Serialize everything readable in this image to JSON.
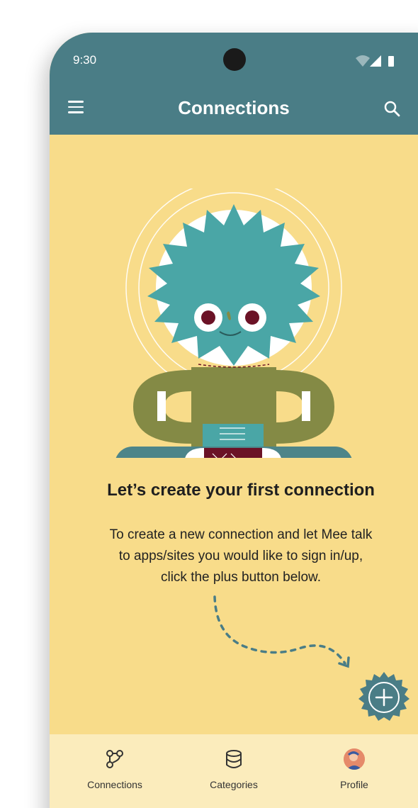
{
  "status_bar": {
    "time": "9:30"
  },
  "app_bar": {
    "title": "Connections"
  },
  "empty_state": {
    "headline": "Let’s create your first connection",
    "body_lines": [
      "To create a new connection and let Mee talk",
      "to apps/sites you would like to sign in/up,",
      "click the plus button below."
    ]
  },
  "fab": {
    "icon": "plus-icon"
  },
  "bottom_nav": {
    "items": [
      {
        "label": "Connections",
        "icon": "connections-icon"
      },
      {
        "label": "Categories",
        "icon": "database-icon"
      },
      {
        "label": "Profile",
        "icon": "avatar-icon"
      }
    ]
  },
  "colors": {
    "primary": "#4a7d86",
    "background": "#f8dc8a",
    "nav_background": "#fbecbc",
    "character_teal": "#4aa6a6",
    "character_olive": "#848a45",
    "character_maroon": "#6b1226"
  }
}
